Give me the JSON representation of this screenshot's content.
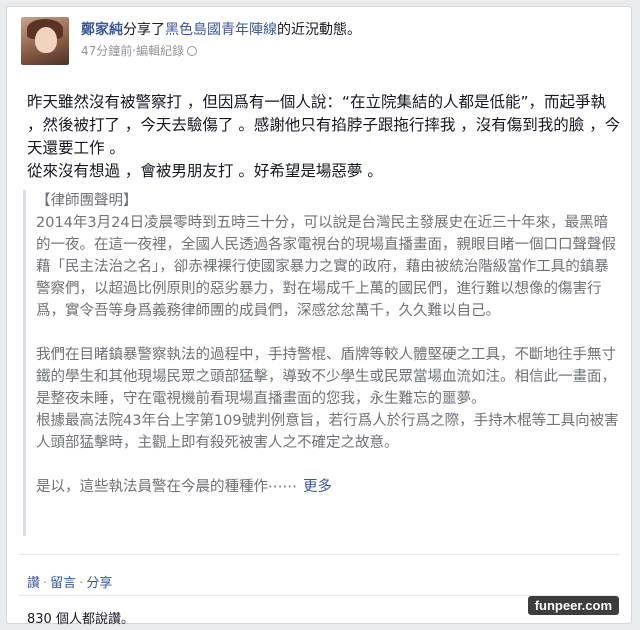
{
  "post": {
    "author": "鄭家純",
    "shared_text": "分享了",
    "page_name": "黑色島國青年陣線",
    "suffix": "的近況動態。",
    "time": "47分鐘前",
    "edit_history": "‧編輯紀錄",
    "body": [
      "昨天雖然沒有被警察打 ，但因爲有一個人說：“在立院集結的人都是低能”，而起爭執 ，然後被打了 ，今天去驗傷了 。感謝他只有掐脖子跟拖行摔我 ，沒有傷到我的臉 ，今天還要工作 。",
      "從來沒有想過 ，會被男朋友打 。好希望是場惡夢 。"
    ]
  },
  "quoted": {
    "heading": "【律師團聲明】",
    "paragraphs": [
      "2014年3月24日凌晨零時到五時三十分，可以說是台灣民主發展史在近三十年來，最黑暗的一夜。在這一夜裡，全國人民透過各家電視台的現場直播畫面，親眼目睹一個口口聲聲假藉「民主法治之名」，卻赤裸裸行使國家暴力之實的政府，藉由被統治階級當作工具的鎮暴警察們，以超過比例原則的惡劣暴力，對在場成千上萬的國民們，進行難以想像的傷害行爲，實令吾等身爲義務律師團的成員們，深感忿忿萬千，久久難以自己。",
      "我們在目睹鎮暴警察執法的過程中，手持警棍、盾牌等較人體堅硬之工具，不斷地往手無寸鐵的學生和其他現場民眾之頭部猛擊，導致不少學生或民眾當場血流如注。相信此一畫面，是整夜未睡，守在電視機前看現場直播畫面的您我，永生難忘的噩夢。",
      "根據最高法院43年台上字第109號判例意旨，若行爲人於行爲之際，手持木棍等工具向被害人頭部猛擊時，主觀上即有殺死被害人之不確定之故意。",
      "是以，這些執法員警在今晨的種種作⋯⋯"
    ],
    "more": "更多"
  },
  "actions": {
    "like": "讚",
    "comment": "留言",
    "share": "分享",
    "separator": "‧"
  },
  "likes_summary": "830 個人都說讚。",
  "watermark": "funpeer.com"
}
